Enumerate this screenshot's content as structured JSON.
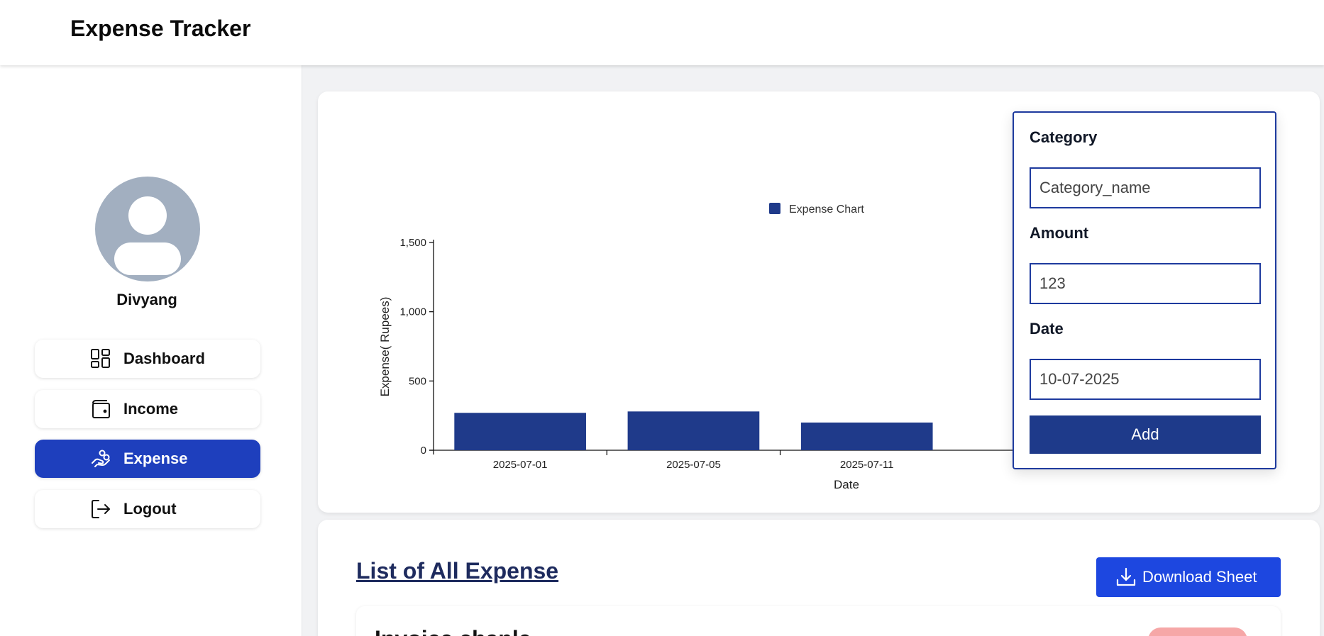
{
  "app": {
    "title": "Expense Tracker"
  },
  "user": {
    "name": "Divyang"
  },
  "sidebar": {
    "items": [
      {
        "label": "Dashboard",
        "icon": "dashboard-grid-icon",
        "active": false
      },
      {
        "label": "Income",
        "icon": "wallet-icon",
        "active": false
      },
      {
        "label": "Expense",
        "icon": "hand-coins-icon",
        "active": true
      },
      {
        "label": "Logout",
        "icon": "logout-icon",
        "active": false
      }
    ]
  },
  "form": {
    "category_label": "Category",
    "category_value": "Category_name",
    "amount_label": "Amount",
    "amount_value": "123",
    "date_label": "Date",
    "date_value": "10-07-2025",
    "add_label": "Add"
  },
  "list": {
    "title": "List of All Expense",
    "download_label": "Download Sheet",
    "first_item_title": "Invoice chanle"
  },
  "colors": {
    "accent": "#1e3a8a",
    "active_nav": "#1e3fbd",
    "download_button": "#1d47e0",
    "avatar": "#a2afc0"
  },
  "chart_data": {
    "type": "bar",
    "categories": [
      "2025-07-01",
      "2025-07-05",
      "2025-07-11"
    ],
    "values": [
      270,
      280,
      200
    ],
    "series": [
      {
        "name": "Expense Chart",
        "values": [
          270,
          280,
          200
        ]
      }
    ],
    "title": "",
    "legend": "Expense Chart",
    "xlabel": "Date",
    "ylabel": "Expense( Rupees)",
    "ylim": [
      0,
      1500
    ],
    "yticks": [
      0,
      500,
      1000,
      1500
    ],
    "ytick_labels": [
      "0",
      "500",
      "1,000",
      "1,500"
    ],
    "color": "#1f3a8a",
    "grid": false,
    "legend_position": "top"
  }
}
